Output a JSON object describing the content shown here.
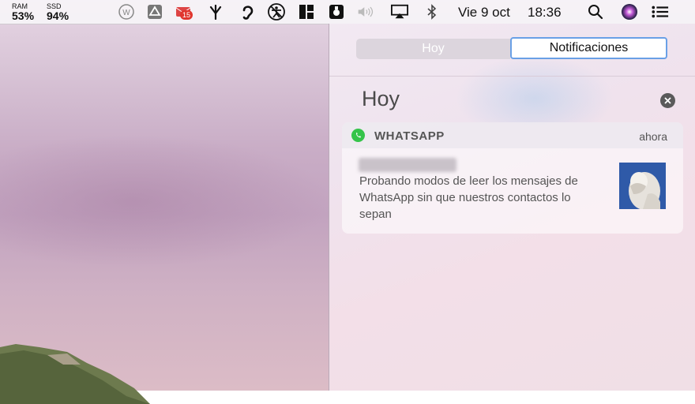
{
  "menubar": {
    "ram_label": "RAM",
    "ram_value": "53%",
    "ssd_label": "SSD",
    "ssd_value": "94%",
    "mail_badge": "15",
    "date": "Vie 9 oct",
    "time": "18:36",
    "icons": [
      "word-icon",
      "google-drive-icon",
      "mail-icon",
      "fork-icon",
      "ear-icon",
      "accessibility-icon",
      "layout-icon",
      "script-icon",
      "volume-icon",
      "airplay-icon",
      "bluetooth-icon",
      "search-icon",
      "siri-icon",
      "notification-center-icon"
    ]
  },
  "notification_center": {
    "tabs": {
      "today": "Hoy",
      "notifications": "Notificaciones"
    },
    "section_title": "Hoy",
    "notification": {
      "app": "WHATSAPP",
      "time": "ahora",
      "message": "Probando modos de leer los mensajes de WhatsApp sin que nuestros contactos lo sepan"
    }
  },
  "colors": {
    "whatsapp_green": "#35c44a",
    "focus_blue": "#6aa0e6",
    "badge_red": "#e0362e"
  }
}
